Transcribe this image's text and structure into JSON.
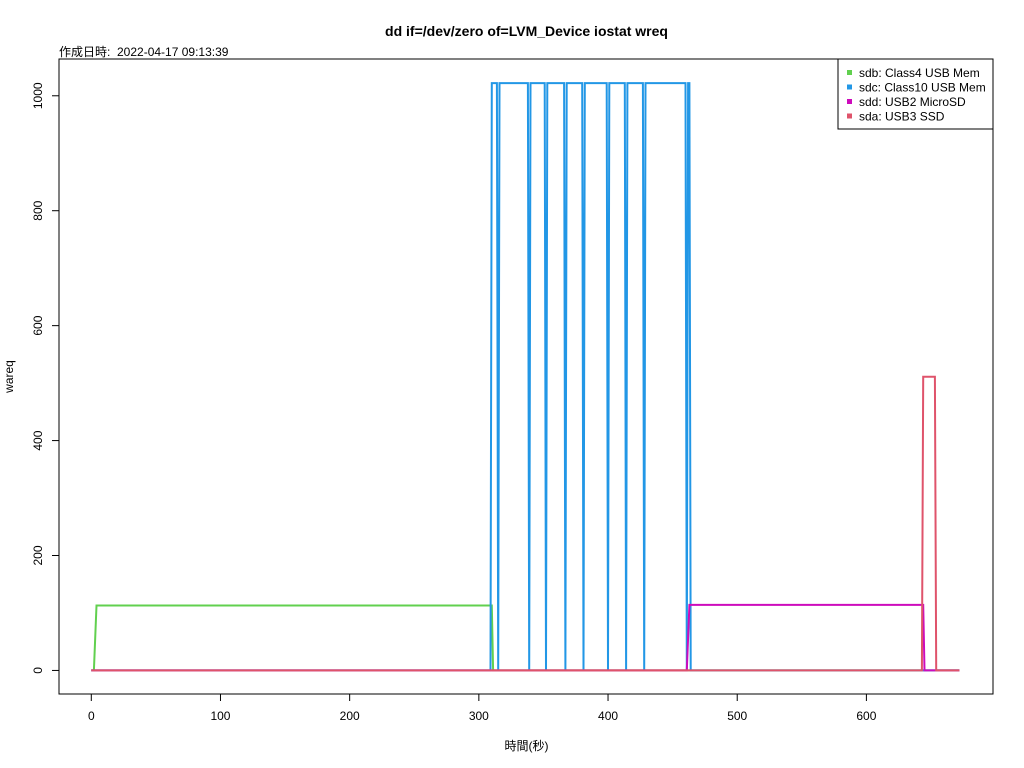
{
  "chart_data": {
    "type": "line",
    "title": "dd if=/dev/zero of=LVM_Device iostat wreq",
    "subtitle": "作成日時:  2022-04-17 09:13:39",
    "xlabel": "時間(秒)",
    "ylabel": "wareq",
    "xlim": [
      -25,
      698
    ],
    "ylim": [
      -41,
      1064
    ],
    "x_ticks": [
      0,
      100,
      200,
      300,
      400,
      500,
      600
    ],
    "y_ticks": [
      0,
      200,
      400,
      600,
      800,
      1000
    ],
    "grid": false,
    "legend_position": "top-right",
    "series": [
      {
        "name": "sdb: Class4 USB Mem",
        "color": "#61D04F",
        "x": [
          0,
          2,
          4,
          308,
          309,
          310,
          311,
          672
        ],
        "y": [
          0,
          0,
          113,
          113,
          113,
          113,
          0,
          0
        ]
      },
      {
        "name": "sdc: Class10 USB Mem",
        "color": "#2297E6",
        "x": [
          0,
          308,
          309,
          310,
          314,
          315,
          316,
          338,
          339,
          340,
          351,
          352,
          353,
          366,
          367,
          368,
          380,
          381,
          382,
          399,
          400,
          401,
          413,
          414,
          415,
          427,
          428,
          429,
          460,
          461,
          462,
          463,
          464,
          672
        ],
        "y": [
          0,
          0,
          0,
          1022,
          1022,
          0,
          1022,
          1022,
          0,
          1022,
          1022,
          0,
          1022,
          1022,
          0,
          1022,
          1022,
          0,
          1022,
          1022,
          0,
          1022,
          1022,
          0,
          1022,
          1022,
          0,
          1022,
          1022,
          0,
          1022,
          1022,
          0,
          0
        ]
      },
      {
        "name": "sdd: USB2 MicroSD",
        "color": "#CD0BBC",
        "x": [
          0,
          461,
          463,
          643,
          644,
          645,
          672
        ],
        "y": [
          0,
          0,
          114,
          114,
          114,
          0,
          0
        ]
      },
      {
        "name": "sda: USB3 SSD",
        "color": "#DF536B",
        "x": [
          0,
          642,
          643,
          644,
          653,
          654,
          655,
          672
        ],
        "y": [
          0,
          0,
          0,
          511,
          511,
          0,
          0,
          0
        ]
      }
    ]
  }
}
